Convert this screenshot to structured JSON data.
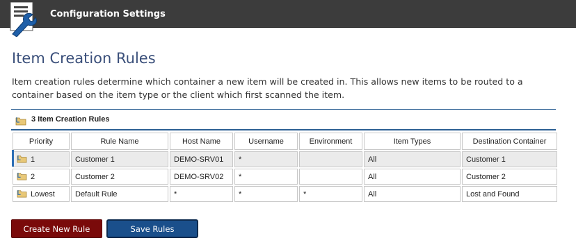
{
  "header": {
    "title": "Configuration Settings",
    "icon": "config-tool-icon",
    "background": "#3c3c3c"
  },
  "page": {
    "title": "Item Creation Rules",
    "description": "Item creation rules determine which container a new item will be created in. This allows new items to be routed to a container based on the item type or the client which first scanned the item."
  },
  "panel": {
    "label": "3 Item Creation Rules",
    "icon": "rule-folder-icon",
    "accent": "#2b5f93"
  },
  "table": {
    "columns": [
      "Priority",
      "Rule Name",
      "Host Name",
      "Username",
      "Environment",
      "Item Types",
      "Destination Container"
    ],
    "rows": [
      {
        "priority": "1",
        "rule_name": "Customer 1",
        "host_name": "DEMO-SRV01",
        "username": "*",
        "environment": "",
        "item_types": "All",
        "destination": "Customer 1",
        "selected": true
      },
      {
        "priority": "2",
        "rule_name": "Customer 2",
        "host_name": "DEMO-SRV02",
        "username": "*",
        "environment": "",
        "item_types": "All",
        "destination": "Customer 2",
        "selected": false
      },
      {
        "priority": "Lowest",
        "rule_name": "Default Rule",
        "host_name": "*",
        "username": "*",
        "environment": "*",
        "item_types": "All",
        "destination": "Lost and Found",
        "selected": false
      }
    ]
  },
  "buttons": {
    "create_label": "Create New Rule",
    "create_color": "#7a0a0a",
    "save_label": "Save Rules",
    "save_color": "#1a4f8b"
  }
}
